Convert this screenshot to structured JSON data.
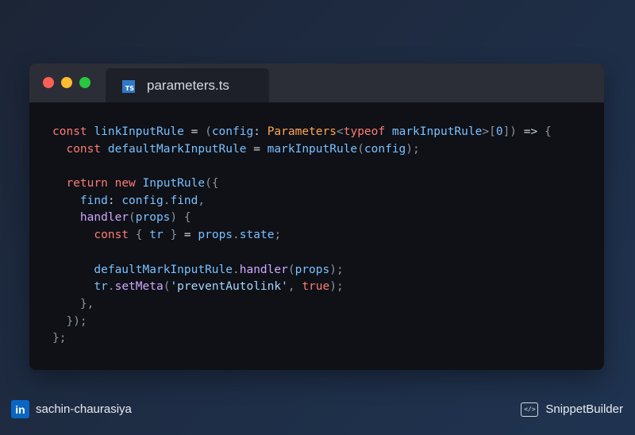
{
  "window": {
    "tab": {
      "filename": "parameters.ts",
      "icon": "typescript-icon",
      "icon_text": "TS"
    }
  },
  "code": {
    "language": "typescript",
    "lines": [
      "const linkInputRule = (config: Parameters<typeof markInputRule>[0]) => {",
      "  const defaultMarkInputRule = markInputRule(config);",
      "",
      "  return new InputRule({",
      "    find: config.find,",
      "    handler(props) {",
      "      const { tr } = props.state;",
      "",
      "      defaultMarkInputRule.handler(props);",
      "      tr.setMeta('preventAutolink', true);",
      "    },",
      "  });",
      "};"
    ]
  },
  "footer": {
    "author": "sachin-chaurasiya",
    "author_icon": "linkedin-icon",
    "author_icon_text": "in",
    "brand": "SnippetBuilder",
    "brand_icon": "code-window-icon",
    "brand_icon_text": "</>"
  },
  "colors": {
    "keyword": "#ff7b72",
    "identifier": "#79c0ff",
    "type": "#ffa657",
    "string": "#a5d6ff",
    "punctuation": "#8b949e",
    "dot_red": "#fe5f57",
    "dot_yellow": "#febc2e",
    "dot_green": "#28c840"
  }
}
